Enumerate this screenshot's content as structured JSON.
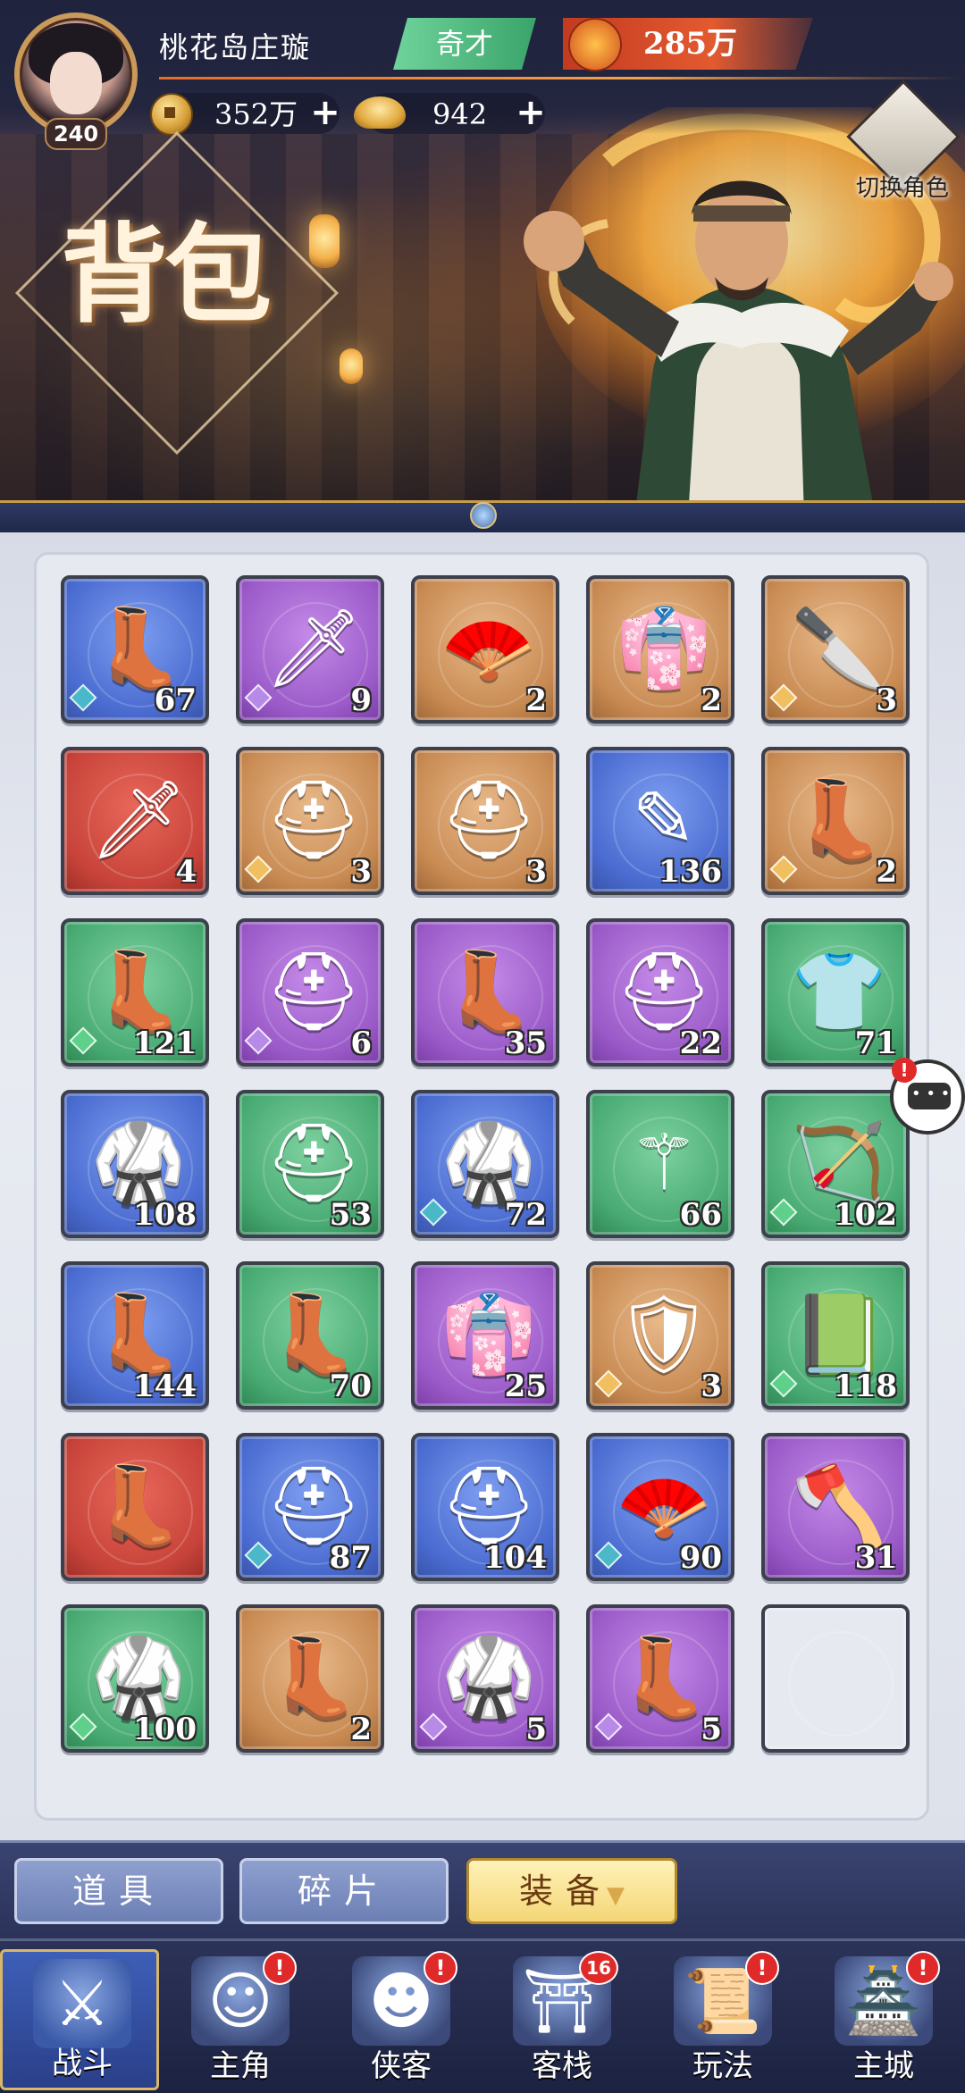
{
  "player": {
    "name": "桃花岛庄璇",
    "level": "240",
    "rank": "奇才",
    "power": "285万"
  },
  "resources": {
    "coins": "352万",
    "ingots": "942",
    "plus": "+"
  },
  "hero": {
    "switch_role_label": "切换角色",
    "page_title": "背包"
  },
  "inventory": {
    "items": [
      {
        "icon": "boots-icon",
        "glyph": "👢",
        "quality": "blue",
        "count": "67",
        "gem": true
      },
      {
        "icon": "sword-icon",
        "glyph": "🗡",
        "quality": "purple",
        "count": "9",
        "gem": true
      },
      {
        "icon": "fan-icon",
        "glyph": "🪭",
        "quality": "orange",
        "count": "2",
        "gem": false
      },
      {
        "icon": "robe-icon",
        "glyph": "👘",
        "quality": "orange",
        "count": "2",
        "gem": false
      },
      {
        "icon": "blade-icon",
        "glyph": "🔪",
        "quality": "orange",
        "count": "3",
        "gem": true
      },
      {
        "icon": "curved-blade-icon",
        "glyph": "🗡",
        "quality": "red",
        "count": "4",
        "gem": false
      },
      {
        "icon": "helmet-icon",
        "glyph": "⛑",
        "quality": "orange",
        "count": "3",
        "gem": true
      },
      {
        "icon": "cap-icon",
        "glyph": "⛑",
        "quality": "orange",
        "count": "3",
        "gem": false
      },
      {
        "icon": "whisk-icon",
        "glyph": "✎",
        "quality": "blue",
        "count": "136",
        "gem": false
      },
      {
        "icon": "boots-icon",
        "glyph": "👢",
        "quality": "orange",
        "count": "2",
        "gem": true
      },
      {
        "icon": "boots-icon",
        "glyph": "👢",
        "quality": "green",
        "count": "121",
        "gem": true
      },
      {
        "icon": "helmet-icon",
        "glyph": "⛑",
        "quality": "purple",
        "count": "6",
        "gem": true
      },
      {
        "icon": "boots-icon",
        "glyph": "👢",
        "quality": "purple",
        "count": "35",
        "gem": false
      },
      {
        "icon": "hood-icon",
        "glyph": "⛑",
        "quality": "purple",
        "count": "22",
        "gem": false
      },
      {
        "icon": "tunic-icon",
        "glyph": "👕",
        "quality": "green",
        "count": "71",
        "gem": false
      },
      {
        "icon": "robe-icon",
        "glyph": "🥋",
        "quality": "blue",
        "count": "108",
        "gem": false
      },
      {
        "icon": "cap-icon",
        "glyph": "⛑",
        "quality": "green",
        "count": "53",
        "gem": false
      },
      {
        "icon": "armor-icon",
        "glyph": "🥋",
        "quality": "blue",
        "count": "72",
        "gem": true
      },
      {
        "icon": "mace-icon",
        "glyph": "⚚",
        "quality": "green",
        "count": "66",
        "gem": false
      },
      {
        "icon": "bow-icon",
        "glyph": "🏹",
        "quality": "green",
        "count": "102",
        "gem": true
      },
      {
        "icon": "boots-icon",
        "glyph": "👢",
        "quality": "blue",
        "count": "144",
        "gem": false
      },
      {
        "icon": "boots-icon",
        "glyph": "👢",
        "quality": "green",
        "count": "70",
        "gem": false
      },
      {
        "icon": "robe-icon",
        "glyph": "👘",
        "quality": "purple",
        "count": "25",
        "gem": false
      },
      {
        "icon": "armor-icon",
        "glyph": "🛡",
        "quality": "orange",
        "count": "3",
        "gem": true
      },
      {
        "icon": "book-icon",
        "glyph": "📗",
        "quality": "green",
        "count": "118",
        "gem": true
      },
      {
        "icon": "boots-icon",
        "glyph": "👢",
        "quality": "red",
        "count": "",
        "gem": false
      },
      {
        "icon": "cap-icon",
        "glyph": "⛑",
        "quality": "blue",
        "count": "87",
        "gem": true
      },
      {
        "icon": "cap-icon",
        "glyph": "⛑",
        "quality": "blue",
        "count": "104",
        "gem": false
      },
      {
        "icon": "fan-icon",
        "glyph": "🪭",
        "quality": "blue",
        "count": "90",
        "gem": true
      },
      {
        "icon": "halberd-icon",
        "glyph": "🪓",
        "quality": "purple",
        "count": "31",
        "gem": false
      },
      {
        "icon": "robe-icon",
        "glyph": "🥋",
        "quality": "green",
        "count": "100",
        "gem": true
      },
      {
        "icon": "boots-icon",
        "glyph": "👢",
        "quality": "orange",
        "count": "2",
        "gem": false
      },
      {
        "icon": "armor-icon",
        "glyph": "🥋",
        "quality": "purple",
        "count": "5",
        "gem": true
      },
      {
        "icon": "boots-icon",
        "glyph": "👢",
        "quality": "purple",
        "count": "5",
        "gem": true
      },
      {
        "icon": "empty-slot",
        "glyph": "",
        "quality": "empty",
        "count": "",
        "gem": false
      }
    ]
  },
  "chat": {
    "alert": "!"
  },
  "filters": {
    "items": "道具",
    "fragments": "碎片",
    "equipment": "装备",
    "caret": "▼"
  },
  "nav": [
    {
      "label": "战斗",
      "icon": "crossed-swords-icon",
      "glyph": "⚔",
      "badge": "",
      "active": true
    },
    {
      "label": "主角",
      "icon": "hero-portrait-icon",
      "glyph": "☺",
      "badge": "!",
      "active": false
    },
    {
      "label": "侠客",
      "icon": "straw-hat-icon",
      "glyph": "☻",
      "badge": "!",
      "active": false
    },
    {
      "label": "客栈",
      "icon": "inn-gate-icon",
      "glyph": "⛩",
      "badge": "16",
      "active": false
    },
    {
      "label": "玩法",
      "icon": "scroll-icon",
      "glyph": "📜",
      "badge": "!",
      "active": false
    },
    {
      "label": "主城",
      "icon": "city-tower-icon",
      "glyph": "🏯",
      "badge": "!",
      "active": false
    }
  ],
  "colors": {
    "gem_blue": "#4ab8c8",
    "gem_purple": "#b88ae8",
    "gem_orange": "#f0c060",
    "gem_green": "#5fd08a"
  }
}
